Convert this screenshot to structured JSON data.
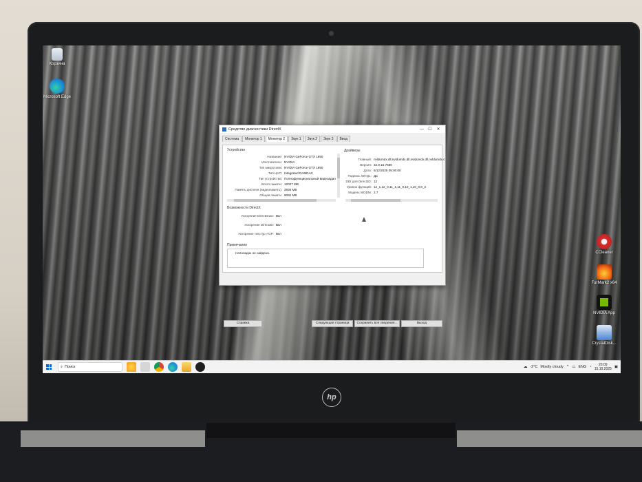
{
  "desktop": {
    "icons_left": [
      {
        "label": "Корзина",
        "icon": "recycle-bin-icon"
      },
      {
        "label": "Microsoft Edge",
        "icon": "edge-icon"
      }
    ],
    "icons_right": [
      {
        "label": "CCleaner",
        "icon": "ccleaner-icon"
      },
      {
        "label": "FurMark2 x64",
        "icon": "furmark-icon"
      },
      {
        "label": "NVIDIA App",
        "icon": "nvidia-icon"
      },
      {
        "label": "CrystalDisk...",
        "icon": "crystaldisk-icon"
      }
    ]
  },
  "dialog": {
    "title": "Средство диагностики DirectX",
    "controls": {
      "minimize": "—",
      "maximize": "☐",
      "close": "✕"
    },
    "tabs": [
      "Система",
      "Монитор 1",
      "Монитор 2",
      "Звук 1",
      "Звук 2",
      "Звук 3",
      "Ввод"
    ],
    "active_tab": "Монитор 2",
    "device_group": "Устройство",
    "device": [
      {
        "k": "Название:",
        "v": "NVIDIA GeForce GTX 1650"
      },
      {
        "k": "Изготовитель:",
        "v": "NVIDIA"
      },
      {
        "k": "Тип микросхем:",
        "v": "NVIDIA GeForce GTX 1650"
      },
      {
        "k": "Тип ЦАП:",
        "v": "Integrated RAMDAC"
      },
      {
        "k": "Тип устройства:",
        "v": "Полнофункциональный видеоадап"
      },
      {
        "k": "Всего памяти:",
        "v": "12027 MB"
      },
      {
        "k": "Память дисплея (видеопамять):",
        "v": "3935 MB"
      },
      {
        "k": "Общая память:",
        "v": "8092 MB"
      }
    ],
    "drivers_group": "Драйверы",
    "drivers": [
      {
        "k": "Главный:",
        "v": "nvldumdx.dll,nvldumdx.dll,nvldumdx.dll,nvldumdx.c"
      },
      {
        "k": "Версия:",
        "v": "32.0.15.7680"
      },
      {
        "k": "Дата:",
        "v": "6/12/2025 05:00:00"
      },
      {
        "k": "Подпись WHQL:",
        "v": "Да"
      },
      {
        "k": "DDI для Direct3D:",
        "v": "12"
      },
      {
        "k": "Уровни функций:",
        "v": "12_1,12_0,11_1,11_0,10_1,10_0,9_3"
      },
      {
        "k": "Модель WDDM:",
        "v": "2.7"
      }
    ],
    "dx_group": "Возможности DirectX",
    "dx": [
      {
        "k": "Ускорение DirectDraw:",
        "v": "Вкл"
      },
      {
        "k": "Ускорение Direct3D:",
        "v": "Вкл"
      },
      {
        "k": "Ускорение текстур AGP:",
        "v": "Вкл"
      }
    ],
    "notes_group": "Примечания",
    "notes": [
      "Неполадок не найдено."
    ],
    "buttons": {
      "help": "Справка",
      "next": "Следующая страница",
      "save": "Сохранить все сведения...",
      "exit": "Выход"
    }
  },
  "taskbar": {
    "search_placeholder": "Поиск",
    "apps": [
      "copilot-icon",
      "task-view-icon",
      "chrome-icon",
      "edge-icon",
      "explorer-icon",
      "xbox-icon"
    ],
    "weather": {
      "temp": "-2°C",
      "condition": "Mostly cloudy"
    },
    "language": "ENG",
    "time": "20:09",
    "date": "15.10.2025"
  },
  "laptop": {
    "brand": "hp"
  }
}
